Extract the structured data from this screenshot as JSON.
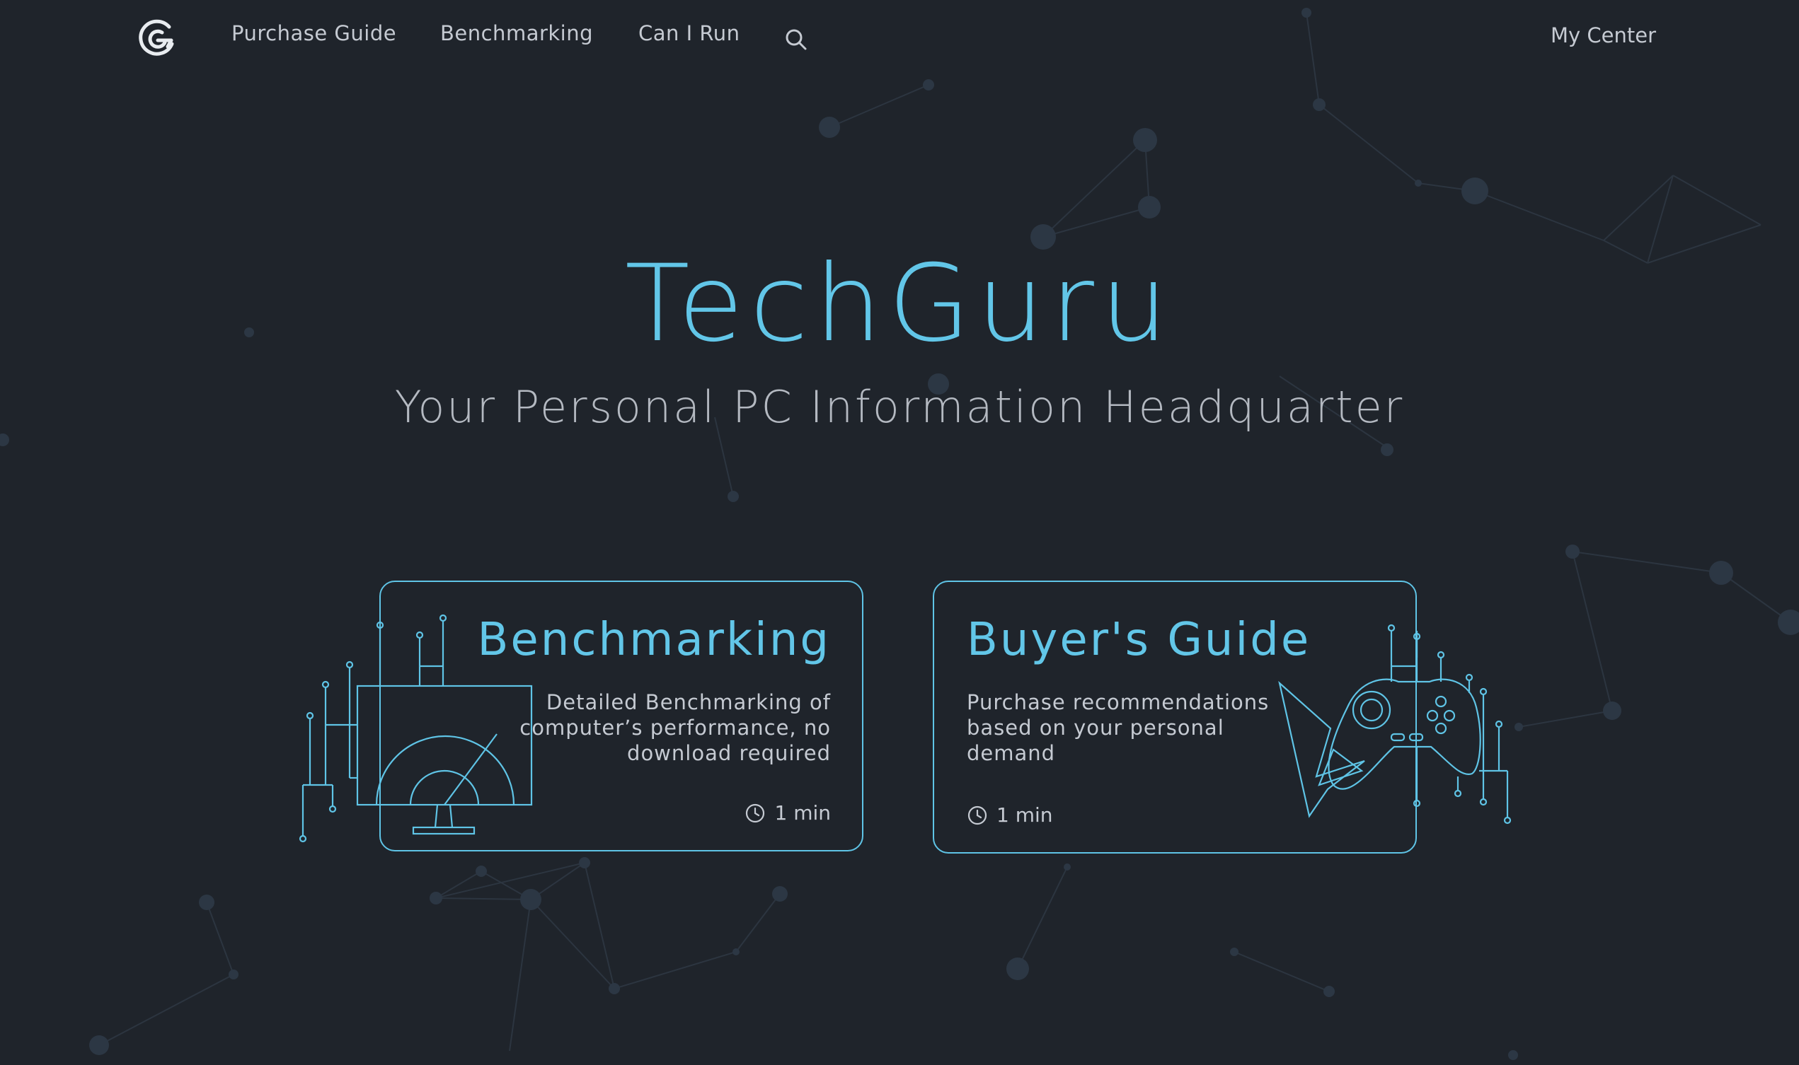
{
  "nav": {
    "links": [
      "Purchase Guide",
      "Benchmarking",
      "Can I Run"
    ],
    "my_center": "My Center"
  },
  "hero": {
    "title": "TechGuru",
    "subtitle": "Your Personal PC Information Headquarter"
  },
  "cards": [
    {
      "title": "Benchmarking",
      "description": "Detailed Benchmarking of computer’s performance, no download required",
      "time": "1 min"
    },
    {
      "title": "Buyer's Guide",
      "description": "Purchase recommendations based on your personal demand",
      "time": "1 min"
    }
  ],
  "colors": {
    "background": "#1f242b",
    "accent": "#5fc4e6",
    "text": "#c5cad2"
  },
  "icons": [
    "logo-icon",
    "search-icon",
    "clock-icon",
    "monitor-gauge-icon",
    "gamepad-icon"
  ]
}
